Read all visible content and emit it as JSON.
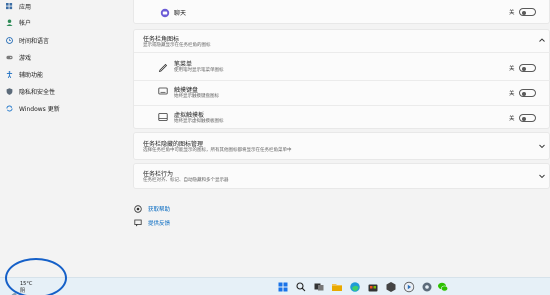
{
  "sidebar": {
    "items": [
      {
        "label": "应用",
        "icon": "apps-icon"
      },
      {
        "label": "帐户",
        "icon": "account-icon"
      },
      {
        "label": "时间和语言",
        "icon": "time-language-icon"
      },
      {
        "label": "游戏",
        "icon": "gaming-icon"
      },
      {
        "label": "辅助功能",
        "icon": "accessibility-icon"
      },
      {
        "label": "隐私和安全性",
        "icon": "privacy-shield-icon"
      },
      {
        "label": "Windows 更新",
        "icon": "windows-update-icon"
      }
    ]
  },
  "chat_row": {
    "label": "聊天",
    "toggle_text": "关",
    "icon": "chat-icon"
  },
  "corner_icons": {
    "title": "任务栏角图标",
    "subtitle": "显示或隐藏显示在任务栏角的图标",
    "rows": [
      {
        "title": "笔菜单",
        "subtitle": "使用笔时显示笔菜单图标",
        "toggle_text": "关",
        "icon": "pen-icon"
      },
      {
        "title": "触摸键盘",
        "subtitle": "始终显示触摸键盘图标",
        "toggle_text": "关",
        "icon": "keyboard-icon"
      },
      {
        "title": "虚拟触摸板",
        "subtitle": "始终显示虚拟触摸板图标",
        "toggle_text": "关",
        "icon": "touchpad-icon"
      }
    ]
  },
  "overflow": {
    "title": "任务栏隐藏的图标管理",
    "subtitle": "选择任务栏角中可能显示的图标，所有其他图标都将显示在任务栏角菜单中"
  },
  "behaviors": {
    "title": "任务栏行为",
    "subtitle": "任务栏对齐、标记、自动隐藏和多个显示器"
  },
  "help": {
    "get_help": "获取帮助",
    "feedback": "提供反馈"
  },
  "taskbar": {
    "temperature": "15°C",
    "condition": "阴",
    "icons": [
      "windows-start-icon",
      "search-icon",
      "task-view-icon",
      "file-explorer-icon",
      "edge-browser-icon",
      "store-icon",
      "app-icon",
      "media-player-icon",
      "settings-gear-icon",
      "wechat-icon"
    ]
  },
  "colors": {
    "link": "#0067c0",
    "annotation": "#1560c8"
  }
}
